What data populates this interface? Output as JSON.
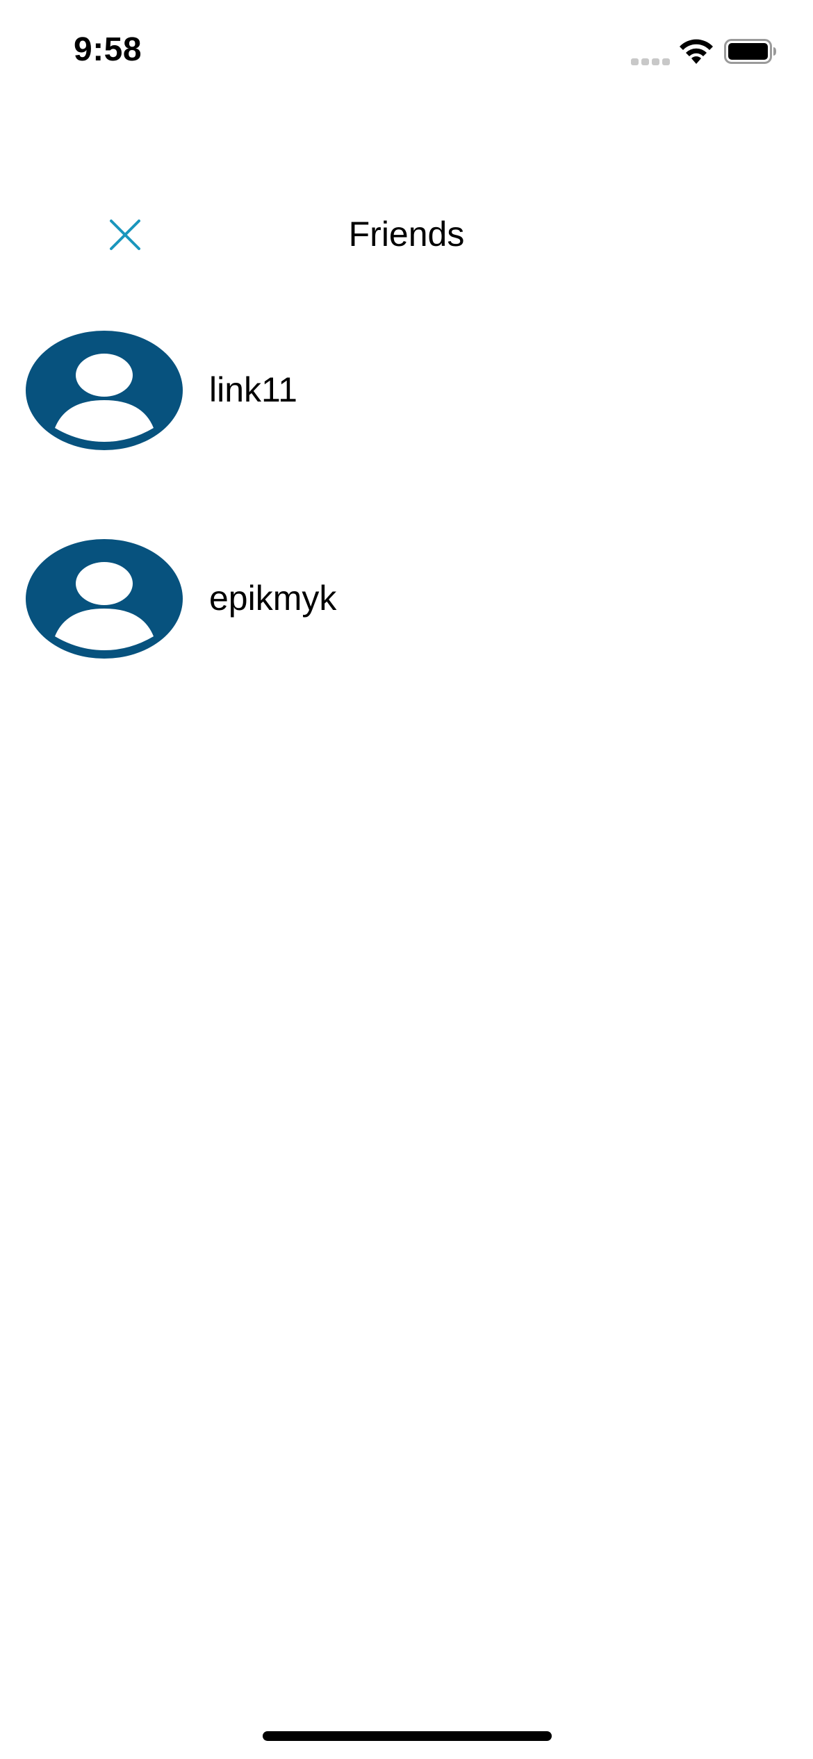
{
  "status_bar": {
    "time": "9:58"
  },
  "nav": {
    "title": "Friends",
    "close_icon": "close-icon"
  },
  "friends": [
    {
      "name": "link11",
      "avatar_icon": "user-avatar-icon"
    },
    {
      "name": "epikmyk",
      "avatar_icon": "user-avatar-icon"
    }
  ],
  "colors": {
    "accent": "#1a96bd",
    "avatar": "#07527e",
    "text": "#000000",
    "background": "#ffffff"
  }
}
